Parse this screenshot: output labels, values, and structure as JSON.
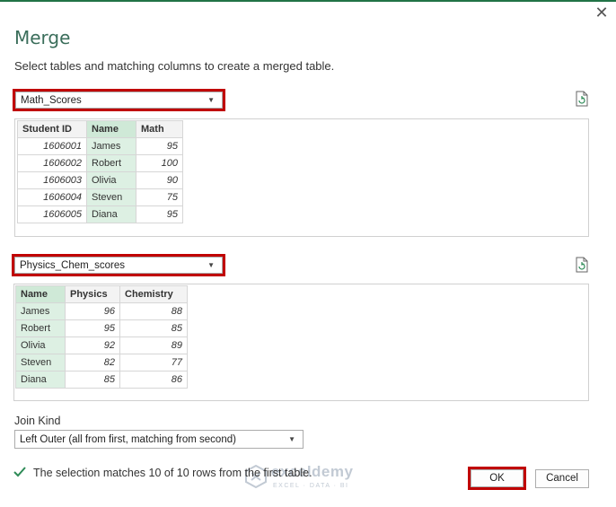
{
  "dialog": {
    "title": "Merge",
    "instruction": "Select tables and matching columns to create a merged table.",
    "close_label": "✕"
  },
  "first_table": {
    "selected": "Math_Scores",
    "columns": [
      "Student ID",
      "Name",
      "Math"
    ],
    "selected_column": "Name",
    "rows": [
      [
        "1606001",
        "James",
        "95"
      ],
      [
        "1606002",
        "Robert",
        "100"
      ],
      [
        "1606003",
        "Olivia",
        "90"
      ],
      [
        "1606004",
        "Steven",
        "75"
      ],
      [
        "1606005",
        "Diana",
        "95"
      ]
    ]
  },
  "second_table": {
    "selected": "Physics_Chem_scores",
    "columns": [
      "Name",
      "Physics",
      "Chemistry"
    ],
    "selected_column": "Name",
    "rows": [
      [
        "James",
        "96",
        "88"
      ],
      [
        "Robert",
        "95",
        "85"
      ],
      [
        "Olivia",
        "92",
        "89"
      ],
      [
        "Steven",
        "82",
        "77"
      ],
      [
        "Diana",
        "85",
        "86"
      ]
    ]
  },
  "join_kind": {
    "label": "Join Kind",
    "selected": "Left Outer (all from first, matching from second)"
  },
  "status": {
    "message": "The selection matches 10 of 10 rows from the first table."
  },
  "buttons": {
    "ok": "OK",
    "cancel": "Cancel"
  },
  "watermark": {
    "name": "exceldemy",
    "tagline": "EXCEL · DATA · BI"
  },
  "colors": {
    "highlight": "#c00000",
    "selected_column": "#ddf0e3",
    "title": "#3b6e5b",
    "check": "#2e8b57"
  }
}
